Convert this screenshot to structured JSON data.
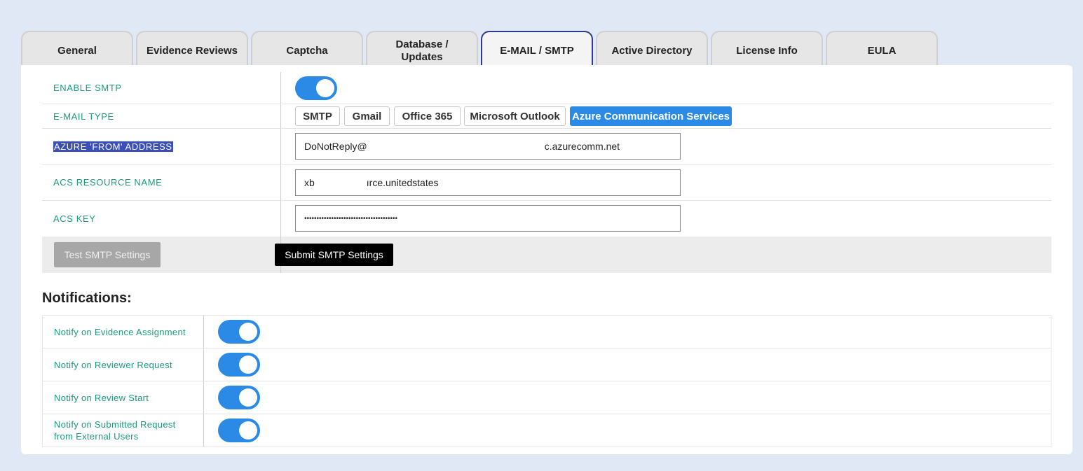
{
  "tabs": [
    {
      "label": "General"
    },
    {
      "label": "Evidence Reviews"
    },
    {
      "label": "Captcha"
    },
    {
      "label": "Database / Updates"
    },
    {
      "label": "E-MAIL / SMTP",
      "active": true
    },
    {
      "label": "Active Directory"
    },
    {
      "label": "License Info"
    },
    {
      "label": "EULA"
    }
  ],
  "smtp": {
    "enable_label": "ENABLE SMTP",
    "enabled": true,
    "email_type_label": "E-MAIL TYPE",
    "email_types": [
      "SMTP",
      "Gmail",
      "Office 365",
      "Microsoft Outlook",
      "Azure Communication Services"
    ],
    "selected_type": "Azure Communication Services",
    "from_label": "AZURE 'FROM' ADDRESS",
    "from_value_start": "DoNotReply@",
    "from_value_end": "c.azurecomm.net",
    "resource_label": "ACS RESOURCE NAME",
    "resource_value_start": "xb",
    "resource_value_end": "ırce.unitedstates",
    "key_label": "ACS KEY",
    "key_value": "••••••••••••••••••••••••••••••••••••••",
    "test_button": "Test SMTP Settings",
    "submit_button": "Submit SMTP Settings"
  },
  "notifications": {
    "heading": "Notifications:",
    "items": [
      {
        "label": "Notify on Evidence Assignment",
        "enabled": true
      },
      {
        "label": "Notify on Reviewer Request",
        "enabled": true
      },
      {
        "label": "Notify on Review Start",
        "enabled": true
      },
      {
        "label": "Notify on Submitted Request from External Users",
        "enabled": true
      }
    ]
  },
  "colors": {
    "accent": "#2b8ae6",
    "label_green": "#1b9a7e",
    "active_tab_border": "#2e3a8c",
    "page_bg": "#e0e7f5",
    "highlight": "#3b4fb8"
  }
}
